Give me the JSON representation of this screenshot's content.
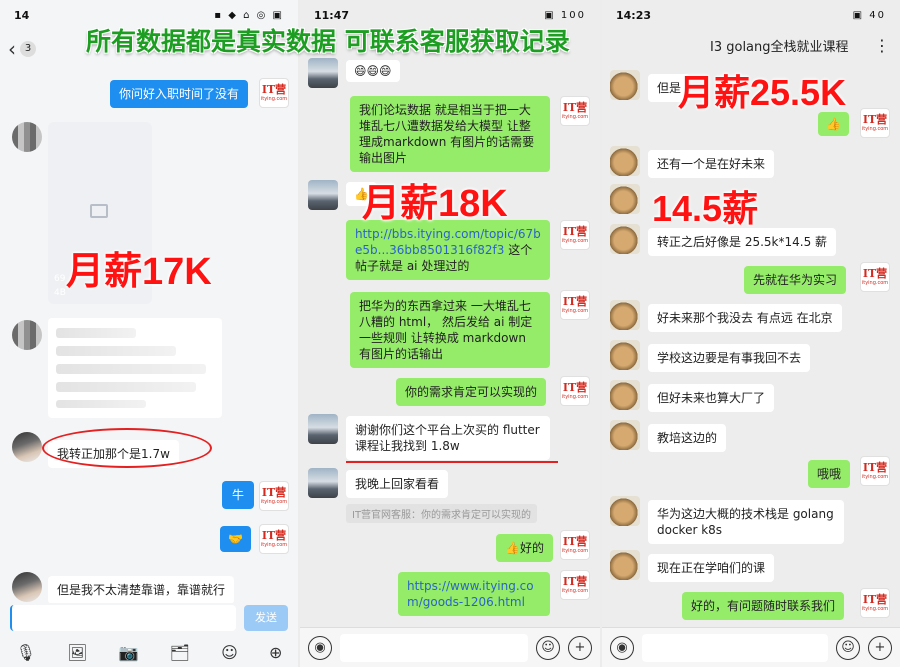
{
  "banner": "所有数据都是真实数据 可联系客服获取记录",
  "panel1": {
    "status_time": "14",
    "status_icons": "▪ ◆ ⌂ ◎ ▣",
    "back_badge": "3",
    "msg_top": "你问好入职时间了没有",
    "image_caption": "69",
    "image_size": "4B",
    "overlay_salary": "月薪17K",
    "msg_circled": "我转正加那个是1.7w",
    "msg_niu": "牛",
    "msg_handshake": "🤝",
    "msg_last": "但是我不太清楚靠谱，靠谱就行",
    "send_label": "发送",
    "toolbar_icons": [
      "mic-icon",
      "image-icon",
      "camera-icon",
      "file-icon",
      "emoji-icon",
      "plus-icon"
    ]
  },
  "panel2": {
    "status_time": "11:47",
    "status_icons": "▣ 100",
    "emoji_top": "😄😄😄",
    "msg_forum": "我们论坛数据 就是相当于把一大堆乱七八遭数据发给大模型 让整理成markdown 有图片的话需要输出图片",
    "msg_thumb": "👍",
    "overlay_salary": "月薪18K",
    "msg_link": "http://bbs.itying.com/topic/67be5b...36bb8501316f82f3",
    "msg_link_suffix": "这个帖子就是 ai 处理过的",
    "msg_huawei": "把华为的东西拿过来 一大堆乱七八糟的 html， 然后发给 ai 制定一些规则 让转换成 markdown 有图片的话输出",
    "msg_need": "你的需求肯定可以实现的",
    "msg_thanks": "谢谢你们这个平台上次买的 flutter 课程让我找到 1.8w",
    "msg_home": "我晚上回家看看",
    "sys_quote": "IT营官网客服：你的需求肯定可以实现的",
    "msg_good": "👍好的",
    "msg_url": "https://www.itying.com/goods-1206.html"
  },
  "panel3": {
    "status_time": "14:23",
    "status_icons": "▣ 40",
    "header_title": "I3 golang全栈就业课程",
    "msg_but": "但是",
    "overlay_salary1": "月薪25.5K",
    "msg_thumb": "👍",
    "msg_another": "还有一个是在好未来",
    "overlay_salary2": "14.5薪",
    "msg_after": "转正之后好像是 25.5k*14.5 薪",
    "msg_intern": "先就在华为实习",
    "msg_far": "好未来那个我没去 有点远 在北京",
    "msg_school": "学校这边要是有事我回不去",
    "msg_big": "但好未来也算大厂了",
    "msg_edu": "教培这边的",
    "msg_oh": "哦哦",
    "msg_stack": "华为这边大概的技术栈是 golang docker k8s",
    "msg_learning": "现在正在学咱们的课",
    "msg_reply": "好的，有问题随时联系我们"
  },
  "it_logo": {
    "main": "IT营",
    "sub": "itying.com"
  },
  "colors": {
    "overlay_red": "#ff1212",
    "banner_green": "#1d9e22",
    "wechat_green": "#95ec69",
    "qq_blue": "#1e8ef0"
  }
}
